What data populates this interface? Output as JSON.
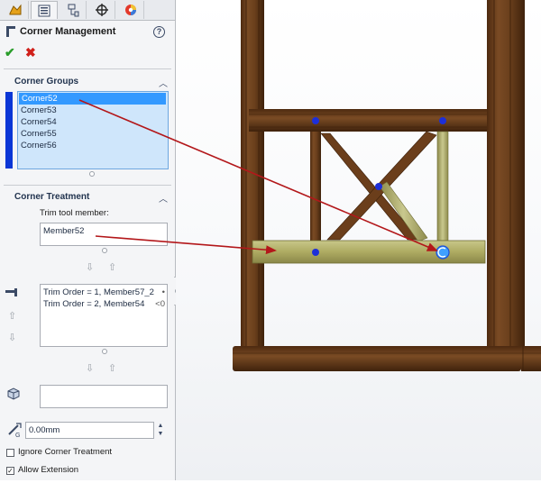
{
  "panel": {
    "tabs": [
      {
        "icon": "feature-manager-icon"
      },
      {
        "icon": "property-manager-icon"
      },
      {
        "icon": "configuration-manager-icon"
      },
      {
        "icon": "dimxpert-icon"
      },
      {
        "icon": "display-manager-icon"
      }
    ],
    "title": "Corner Management",
    "help_icon": "?",
    "ok_icon": "✔",
    "cancel_icon": "✖",
    "corner_groups": {
      "heading": "Corner Groups",
      "items": [
        "Corner52",
        "Corner53",
        "Corner54",
        "Corner55",
        "Corner56"
      ],
      "selected_index": 0
    },
    "corner_treatment": {
      "heading": "Corner Treatment",
      "trim_tool_label": "Trim tool member:",
      "trim_tool_value": "Member52",
      "trim_order": [
        "Trim Order = 1, Member57_2",
        "Trim Order = 2, Member54"
      ],
      "trim_order_suffix": [
        "•",
        "<0"
      ],
      "gap_value": "0.00mm",
      "ignore_label": "Ignore Corner Treatment",
      "ignore_checked": false,
      "allow_extension_label": "Allow Extension",
      "allow_extension_checked": true
    },
    "colors": {
      "accent_blue": "#0a36d6",
      "selection": "#3399ff",
      "list_bg": "#cfe6fb",
      "ok_green": "#2a9d2a",
      "cancel_red": "#d0201a"
    }
  },
  "viewport": {
    "colors": {
      "wood": "#6b3e1b",
      "highlight_member": "#b5b36a",
      "annotation_arrow": "#b3171a",
      "point_marker": "#1d2fd8"
    }
  }
}
